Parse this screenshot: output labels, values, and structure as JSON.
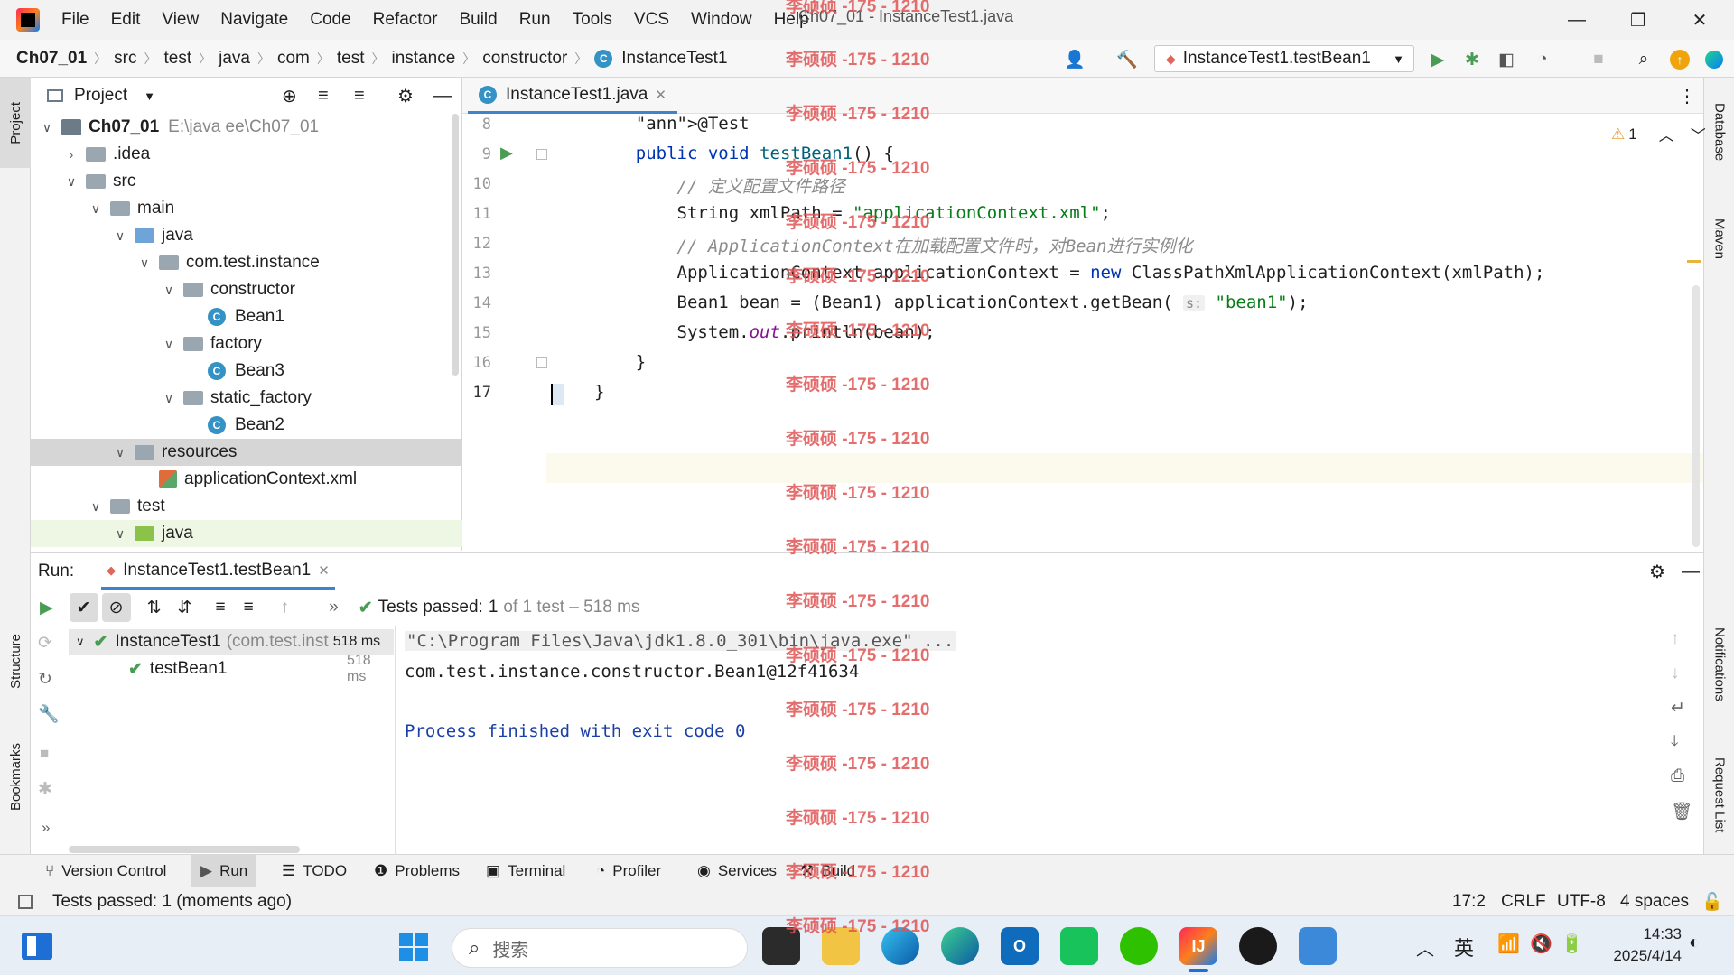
{
  "window": {
    "title": "Ch07_01 - InstanceTest1.java",
    "menu": [
      "File",
      "Edit",
      "View",
      "Navigate",
      "Code",
      "Refactor",
      "Build",
      "Run",
      "Tools",
      "VCS",
      "Window",
      "Help"
    ]
  },
  "breadcrumb": [
    "Ch07_01",
    "src",
    "test",
    "java",
    "com",
    "test",
    "instance",
    "constructor",
    "InstanceTest1"
  ],
  "run_config": "InstanceTest1.testBean1",
  "left_strip": {
    "project": "Project",
    "structure": "Structure",
    "bookmarks": "Bookmarks"
  },
  "right_strip": {
    "database": "Database",
    "maven": "Maven",
    "notifications": "Notifications",
    "request_list": "Request List"
  },
  "project_panel": {
    "title": "Project",
    "tree": [
      {
        "label": "Ch07_01",
        "extra": "E:\\java ee\\Ch07_01",
        "depth": 0,
        "type": "module",
        "expanded": true
      },
      {
        "label": ".idea",
        "depth": 1,
        "type": "folder",
        "expanded": false
      },
      {
        "label": "src",
        "depth": 1,
        "type": "folder",
        "expanded": true
      },
      {
        "label": "main",
        "depth": 2,
        "type": "folder",
        "expanded": true
      },
      {
        "label": "java",
        "depth": 3,
        "type": "folder-blue",
        "expanded": true
      },
      {
        "label": "com.test.instance",
        "depth": 4,
        "type": "package",
        "expanded": true
      },
      {
        "label": "constructor",
        "depth": 5,
        "type": "package",
        "expanded": true
      },
      {
        "label": "Bean1",
        "depth": 6,
        "type": "class"
      },
      {
        "label": "factory",
        "depth": 5,
        "type": "package",
        "expanded": true
      },
      {
        "label": "Bean3",
        "depth": 6,
        "type": "class"
      },
      {
        "label": "static_factory",
        "depth": 5,
        "type": "package",
        "expanded": true
      },
      {
        "label": "Bean2",
        "depth": 6,
        "type": "class"
      },
      {
        "label": "resources",
        "depth": 3,
        "type": "folder-res",
        "expanded": true,
        "selected": true
      },
      {
        "label": "applicationContext.xml",
        "depth": 4,
        "type": "xml"
      },
      {
        "label": "test",
        "depth": 2,
        "type": "folder",
        "expanded": true
      },
      {
        "label": "java",
        "depth": 3,
        "type": "folder-green",
        "expanded": true,
        "highlight": true
      }
    ]
  },
  "editor": {
    "tab": "InstanceTest1.java",
    "warnings": "1",
    "lines": [
      {
        "n": "8",
        "code": "    @Test"
      },
      {
        "n": "9",
        "code": "    public void testBean1() {"
      },
      {
        "n": "10",
        "code": "        // 定义配置文件路径"
      },
      {
        "n": "11",
        "code": "        String xmlPath = \"applicationContext.xml\";"
      },
      {
        "n": "12",
        "code": "        // ApplicationContext在加载配置文件时，对Bean进行实例化"
      },
      {
        "n": "13",
        "code": "        ApplicationContext applicationContext = new ClassPathXmlApplicationContext(xmlPath);"
      },
      {
        "n": "14",
        "code": "        Bean1 bean = (Bean1) applicationContext.getBean( s: \"bean1\");"
      },
      {
        "n": "15",
        "code": "        System.out.println(bean);"
      },
      {
        "n": "16",
        "code": "    }"
      },
      {
        "n": "17",
        "code": "}"
      }
    ]
  },
  "run": {
    "label": "Run:",
    "tab": "InstanceTest1.testBean1",
    "status_prefix": "Tests passed:",
    "status_count": "1",
    "status_suffix": "of 1 test – 518 ms",
    "tree": [
      {
        "name": "InstanceTest1",
        "detail": "(com.test.inst",
        "time": "518 ms"
      },
      {
        "name": "testBean1",
        "time": "518 ms"
      }
    ],
    "console": [
      "\"C:\\Program Files\\Java\\jdk1.8.0_301\\bin\\java.exe\" ...",
      "com.test.instance.constructor.Bean1@12f41634",
      "",
      "Process finished with exit code 0"
    ]
  },
  "bottom_tools": [
    "Version Control",
    "Run",
    "TODO",
    "Problems",
    "Terminal",
    "Profiler",
    "Services",
    "Build"
  ],
  "status": {
    "message": "Tests passed: 1 (moments ago)",
    "position": "17:2",
    "line_sep": "CRLF",
    "encoding": "UTF-8",
    "indent": "4 spaces"
  },
  "taskbar": {
    "search_placeholder": "搜索",
    "ime": "英",
    "time": "14:33",
    "date": "2025/4/14"
  },
  "watermark": "李硕硕 -175 - 1210",
  "colors": {
    "accent": "#4083c9",
    "pass_green": "#499c54",
    "keyword": "#0033b3",
    "string": "#067d17",
    "watermark": "#e05555"
  }
}
